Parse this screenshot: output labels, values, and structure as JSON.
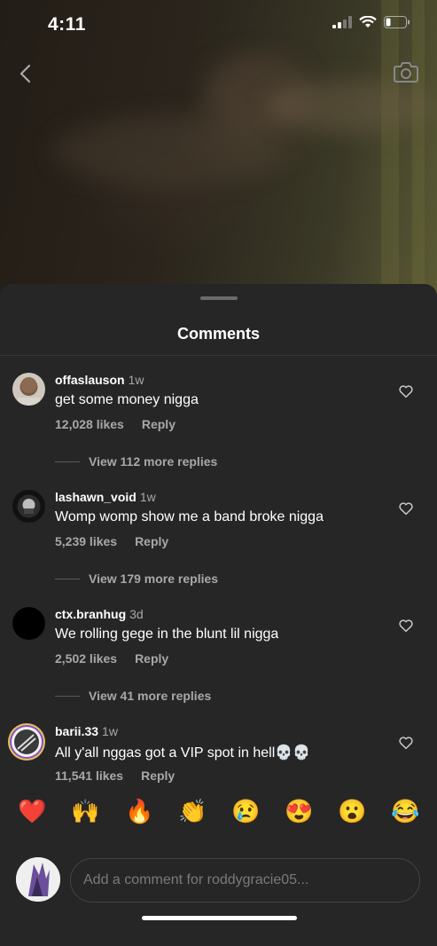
{
  "status_bar": {
    "time": "4:11",
    "icons": [
      "signal-icon",
      "wifi-icon",
      "battery-icon"
    ]
  },
  "top_controls": {
    "back_icon": "chevron-left-icon",
    "camera_icon": "camera-icon"
  },
  "sheet": {
    "title": "Comments"
  },
  "comments": [
    {
      "username": "offaslauson",
      "time": "1w",
      "text": "get some money nigga",
      "likes": "12,028 likes",
      "reply": "Reply",
      "view_replies": "View 112 more replies"
    },
    {
      "username": "lashawn_void",
      "time": "1w",
      "text": "Womp womp show me a band broke nigga",
      "likes": "5,239 likes",
      "reply": "Reply",
      "view_replies": "View 179 more replies"
    },
    {
      "username": "ctx.branhug",
      "time": "3d",
      "text": "We rolling gege in the blunt lil nigga",
      "likes": "2,502 likes",
      "reply": "Reply",
      "view_replies": "View 41 more replies"
    },
    {
      "username": "barii.33",
      "time": "1w",
      "text": "All y'all nggas got a VIP spot in hell💀💀",
      "likes": "11,541 likes",
      "reply": "Reply"
    }
  ],
  "emoji_reactions": [
    "❤️",
    "🙌",
    "🔥",
    "👏",
    "😢",
    "😍",
    "😮",
    "😂"
  ],
  "composer": {
    "placeholder": "Add a comment for roddygracie05..."
  },
  "colors": {
    "sheet_bg": "#262626",
    "secondary_text": "#a8a8a8"
  }
}
